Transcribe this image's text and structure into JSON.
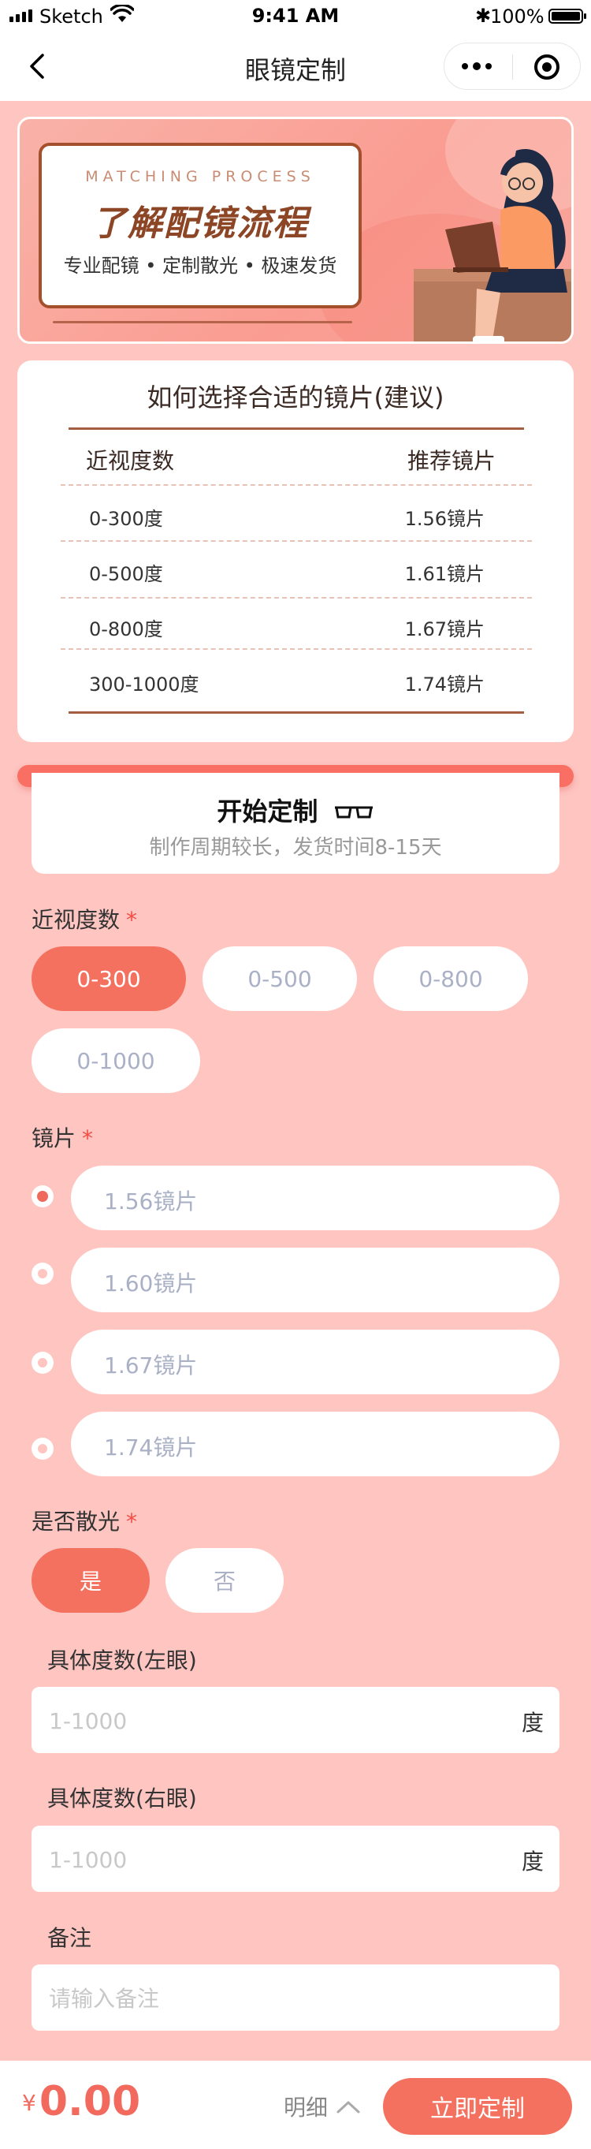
{
  "status_bar": {
    "carrier": "Sketch",
    "time": "9:41 AM",
    "battery": "100%"
  },
  "nav": {
    "title": "眼镜定制"
  },
  "banner": {
    "en_title": "MATCHING PROCESS",
    "zh_title": "了解配镜流程",
    "tags": "专业配镜 • 定制散光 • 极速发货"
  },
  "recommend": {
    "title": "如何选择合适的镜片(建议)",
    "headers": [
      "近视度数",
      "推荐镜片"
    ],
    "rows": [
      [
        "0-300度",
        "1.56镜片"
      ],
      [
        "0-500度",
        "1.61镜片"
      ],
      [
        "0-800度",
        "1.67镜片"
      ],
      [
        "300-1000度",
        "1.74镜片"
      ]
    ]
  },
  "form": {
    "title": "开始定制",
    "subtitle": "制作周期较长，发货时间8-15天",
    "myopia_label": "近视度数",
    "myopia_options": [
      "0-300",
      "0-500",
      "0-800",
      "0-1000"
    ],
    "myopia_selected": "0-300",
    "lens_label": "镜片",
    "lens_options": [
      "1.56镜片",
      "1.60镜片",
      "1.67镜片",
      "1.74镜片"
    ],
    "lens_selected": "1.56镜片",
    "astig_label": "是否散光",
    "astig_options": [
      "是",
      "否"
    ],
    "astig_selected": "是",
    "required_mark": "*",
    "left_label": "具体度数(左眼)",
    "left_placeholder": "1-1000",
    "right_label": "具体度数(右眼)",
    "right_placeholder": "1-1000",
    "unit": "度",
    "note_label": "备注",
    "note_placeholder": "请输入备注"
  },
  "bottom": {
    "currency": "¥",
    "price": "0.00",
    "detail_label": "明细",
    "submit_label": "立即定制"
  },
  "colors": {
    "page_bg": "#fec5c1",
    "accent": "#f47160",
    "required": "#f24c45",
    "price": "#f26a5e"
  }
}
